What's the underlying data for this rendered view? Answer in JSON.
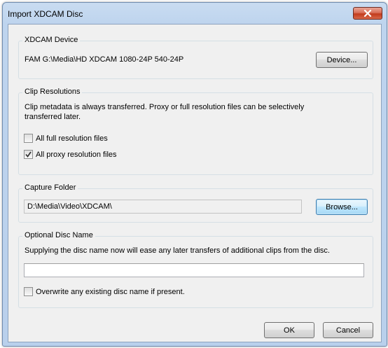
{
  "window": {
    "title": "Import XDCAM Disc",
    "close_icon": "close-x-icon"
  },
  "device_group": {
    "title": "XDCAM Device",
    "device_text": "FAM G:\\Media\\HD XDCAM 1080-24P 540-24P",
    "device_button": "Device..."
  },
  "clip_group": {
    "title": "Clip Resolutions",
    "description_line1": "Clip metadata is always transferred. Proxy or full resolution files can be selectively",
    "description_line2": "transferred later.",
    "full_res_label": "All full resolution files",
    "full_res_checked": false,
    "proxy_label": "All proxy resolution files",
    "proxy_checked": true
  },
  "capture_group": {
    "title": "Capture Folder",
    "folder_value": "D:\\Media\\Video\\XDCAM\\",
    "browse_button": "Browse..."
  },
  "disc_group": {
    "title": "Optional Disc Name",
    "description": "Supplying the disc name now will ease any later transfers of additional clips from the disc.",
    "name_value": "",
    "overwrite_label": "Overwrite any existing disc name if present.",
    "overwrite_checked": false
  },
  "footer": {
    "ok_button": "OK",
    "cancel_button": "Cancel"
  }
}
